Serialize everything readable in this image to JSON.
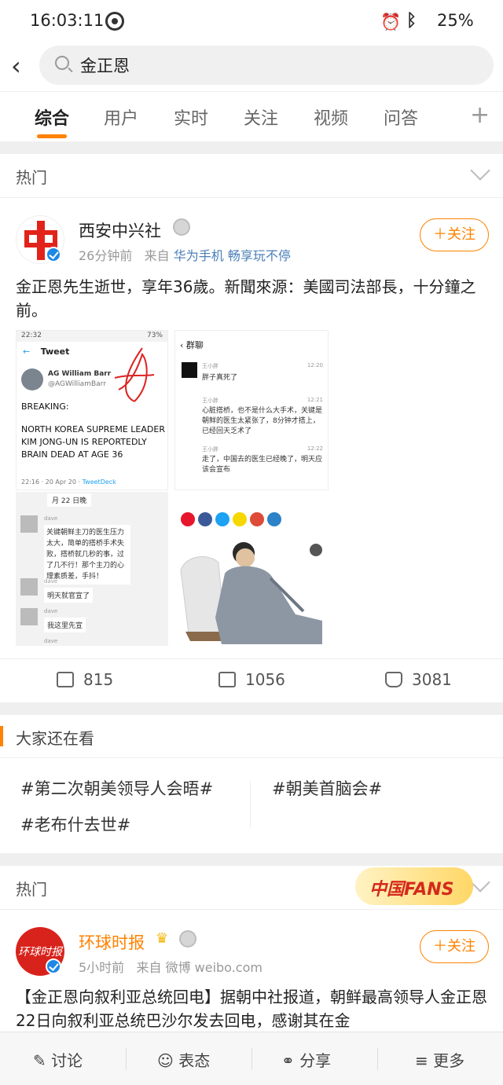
{
  "status": {
    "time": "16:03:11",
    "battery": "25%"
  },
  "search": {
    "query": "金正恩"
  },
  "tabs": [
    "综合",
    "用户",
    "实时",
    "关注",
    "视频",
    "问答"
  ],
  "section1": {
    "label": "热门"
  },
  "post1": {
    "username": "西安中兴社",
    "time": "26分钟前",
    "from_label": "来自",
    "source": "华为手机 畅享玩不停",
    "follow_label": "关注",
    "text": "金正恩先生逝世，享年36歲。新聞來源：美國司法部長，十分鐘之前。",
    "tweet": {
      "status_time": "22:32",
      "status_batt": "73%",
      "header": "Tweet",
      "author": "AG William Barr",
      "handle": "@AGWilliamBarr",
      "line1": "BREAKING:",
      "line2": "NORTH KOREA SUPREME LEADER KIM JONG-UN IS REPORTEDLY BRAIN DEAD AT AGE 36",
      "footer_time": "22:16 · 20 Apr 20 ·",
      "footer_src": "TweetDeck"
    },
    "chat1": {
      "top_text": "月 22 日晚",
      "user": "dave",
      "msg1": "关键朝鲜主刀的医生压力太大，简单的搭桥手术失败，搭桥就几秒的事，过了几不行！那个主刀的心理素质差，手抖！",
      "msg2": "明天就官宣了",
      "msg3": "我这里先宣"
    },
    "chat2": {
      "title": "群聊",
      "name": "王小胖",
      "m1": "胖子真死了",
      "m2": "心脏搭桥，也不是什么大手术，关键是朝鲜的医生太紧张了，8分钟才搭上，已经回天乏术了",
      "m3": "走了，中国去的医生已经晚了，明天应该会宣布",
      "t1": "12:20",
      "t2": "12:21",
      "t3": "12:22"
    },
    "reposts": "815",
    "comments": "1056",
    "likes": "3081"
  },
  "also_watching": {
    "title": "大家还在看",
    "tags": [
      "#第二次朝美领导人会晤#",
      "#朝美首脑会#",
      "#老布什去世#"
    ]
  },
  "section2": {
    "label": "热门",
    "banner": "中国FANS"
  },
  "post2": {
    "username": "环球时报",
    "time": "5小时前",
    "from_label": "来自",
    "source": "微博 weibo.com",
    "follow_label": "关注",
    "text": "【金正恩向叙利亚总统回电】据朝中社报道，朝鲜最高领导人金正恩22日向叙利亚总统巴沙尔发去回电，感谢其在金"
  },
  "bottom": {
    "discuss": "讨论",
    "express": "表态",
    "share": "分享",
    "more": "更多"
  }
}
